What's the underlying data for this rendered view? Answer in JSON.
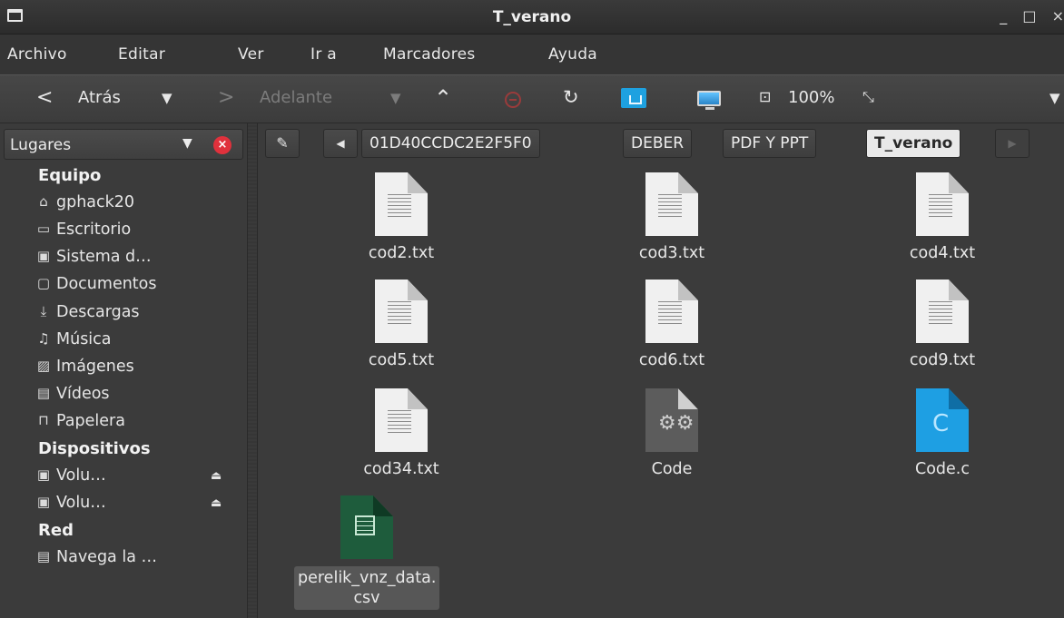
{
  "window": {
    "title": "T_verano",
    "minimize": "_",
    "maximize": "□",
    "close": "×"
  },
  "menu": [
    "Archivo",
    "Editar",
    "Ver",
    "Ir a",
    "Marcadores",
    "Ayuda"
  ],
  "toolbar": {
    "back_arrow": "<",
    "back_label": "Atrás",
    "back_caret": "▼",
    "forward_arrow": ">",
    "forward_label": "Adelante",
    "forward_caret": "▼",
    "up": "⌃",
    "reload": "↻",
    "zoom_icon": "⊡",
    "zoom": "100%",
    "fit_icon": "⤡",
    "more": "▼"
  },
  "sidebar": {
    "header": "Lugares",
    "caret": "▼",
    "close": "×",
    "groups": {
      "equipo": "Equipo",
      "dispositivos": "Dispositivos",
      "red": "Red"
    },
    "places": [
      {
        "icon": "⌂",
        "label": "gphack20"
      },
      {
        "icon": "▭",
        "label": "Escritorio"
      },
      {
        "icon": "▣",
        "label": "Sistema d…"
      },
      {
        "icon": "▢",
        "label": "Documentos"
      },
      {
        "icon": "⤓",
        "label": "Descargas"
      },
      {
        "icon": "♫",
        "label": "Música"
      },
      {
        "icon": "▨",
        "label": "Imágenes"
      },
      {
        "icon": "▤",
        "label": "Vídeos"
      },
      {
        "icon": "⊓",
        "label": "Papelera"
      }
    ],
    "devices": [
      {
        "icon": "▣",
        "label": "Volu…",
        "eject": "⏏"
      },
      {
        "icon": "▣",
        "label": "Volu…",
        "eject": "⏏"
      }
    ],
    "network": [
      {
        "icon": "▤",
        "label": "Navega la …"
      }
    ]
  },
  "pathbar": {
    "edit_icon": "✎",
    "left_arrow": "◀",
    "right_arrow": "▶",
    "crumbs": [
      "01D40CCDC2E2F5F0",
      "DEBER",
      "PDF Y PPT",
      "T_verano"
    ]
  },
  "files": [
    {
      "name": "cod2.txt",
      "type": "text"
    },
    {
      "name": "cod3.txt",
      "type": "text"
    },
    {
      "name": "cod4.txt",
      "type": "text"
    },
    {
      "name": "cod5.txt",
      "type": "text"
    },
    {
      "name": "cod6.txt",
      "type": "text"
    },
    {
      "name": "cod9.txt",
      "type": "text"
    },
    {
      "name": "cod34.txt",
      "type": "text"
    },
    {
      "name": "Code",
      "type": "executable"
    },
    {
      "name": "Code.c",
      "type": "c-source"
    },
    {
      "name": "perelik_vnz_data.\ncsv",
      "type": "spreadsheet"
    }
  ],
  "icons": {
    "gear_glyph": "⚙⚙",
    "c_glyph": "C"
  },
  "colors": {
    "c_source": "#1e9fe3",
    "csv": "#1e5c3c",
    "close_badge": "#e0313c"
  }
}
